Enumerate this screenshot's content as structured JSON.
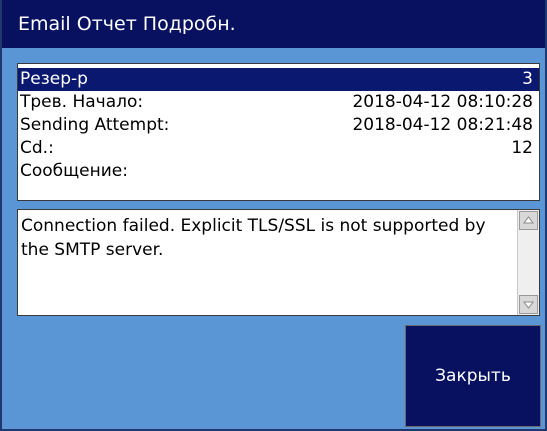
{
  "window": {
    "title": "Email Отчет Подробн."
  },
  "details": {
    "rows": [
      {
        "label": "Резер-р",
        "value": "3"
      },
      {
        "label": "Трев. Начало:",
        "value": "2018-04-12 08:10:28"
      },
      {
        "label": "Sending Attempt:",
        "value": "2018-04-12 08:21:48"
      },
      {
        "label": "Cd.:",
        "value": "12"
      },
      {
        "label": "Сообщение:",
        "value": ""
      }
    ]
  },
  "message": {
    "text": "Connection failed. Explicit TLS/SSL is not supported by the SMTP server."
  },
  "buttons": {
    "close_label": "Закрыть"
  },
  "colors": {
    "title_bg": "#081060",
    "window_bg": "#5a96d6",
    "selected_row_bg": "#0a1870",
    "button_bg": "#081060"
  },
  "icons": {
    "scroll_up": "triangle-up-icon",
    "scroll_down": "triangle-down-icon"
  }
}
